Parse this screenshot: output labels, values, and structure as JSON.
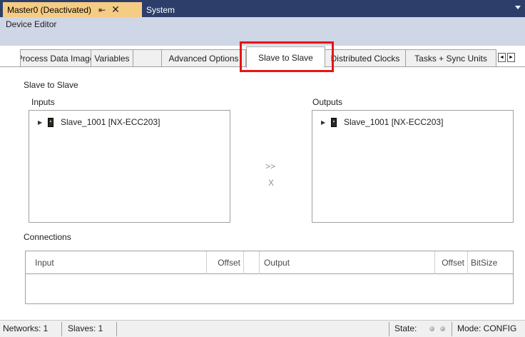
{
  "doc_tabs": {
    "active_label": "Master0 (Deactivated)",
    "pin_glyph": "⇤",
    "close_glyph": "✕",
    "inactive_label": "System"
  },
  "editor": {
    "title": "Device Editor"
  },
  "property_tabs": [
    {
      "label": "Process Data Image"
    },
    {
      "label": "Variables"
    },
    {
      "label": "Advanced Options"
    },
    {
      "label": "Slave to Slave"
    },
    {
      "label": "Distributed Clocks"
    },
    {
      "label": "Tasks + Sync Units"
    }
  ],
  "tab_scroll": {
    "left": "◄",
    "right": "►"
  },
  "content": {
    "section_title": "Slave to Slave",
    "inputs_label": "Inputs",
    "outputs_label": "Outputs",
    "input_tree_item": "Slave_1001 [NX-ECC203]",
    "output_tree_item": "Slave_1001 [NX-ECC203]",
    "add_button": ">>",
    "remove_button": "X",
    "connections_label": "Connections",
    "columns": [
      "Input",
      "Offset",
      "Output",
      "Offset",
      "BitSize"
    ]
  },
  "statusbar": {
    "networks": "Networks: 1",
    "slaves": "Slaves: 1",
    "state_label": "State:",
    "mode": "Mode: CONFIG"
  },
  "colors": {
    "highlight": "#e81414",
    "active_doc_tab": "#f5cc84",
    "doc_tab_strip": "#2d3e6b",
    "editor_header": "#cfd6e5"
  }
}
